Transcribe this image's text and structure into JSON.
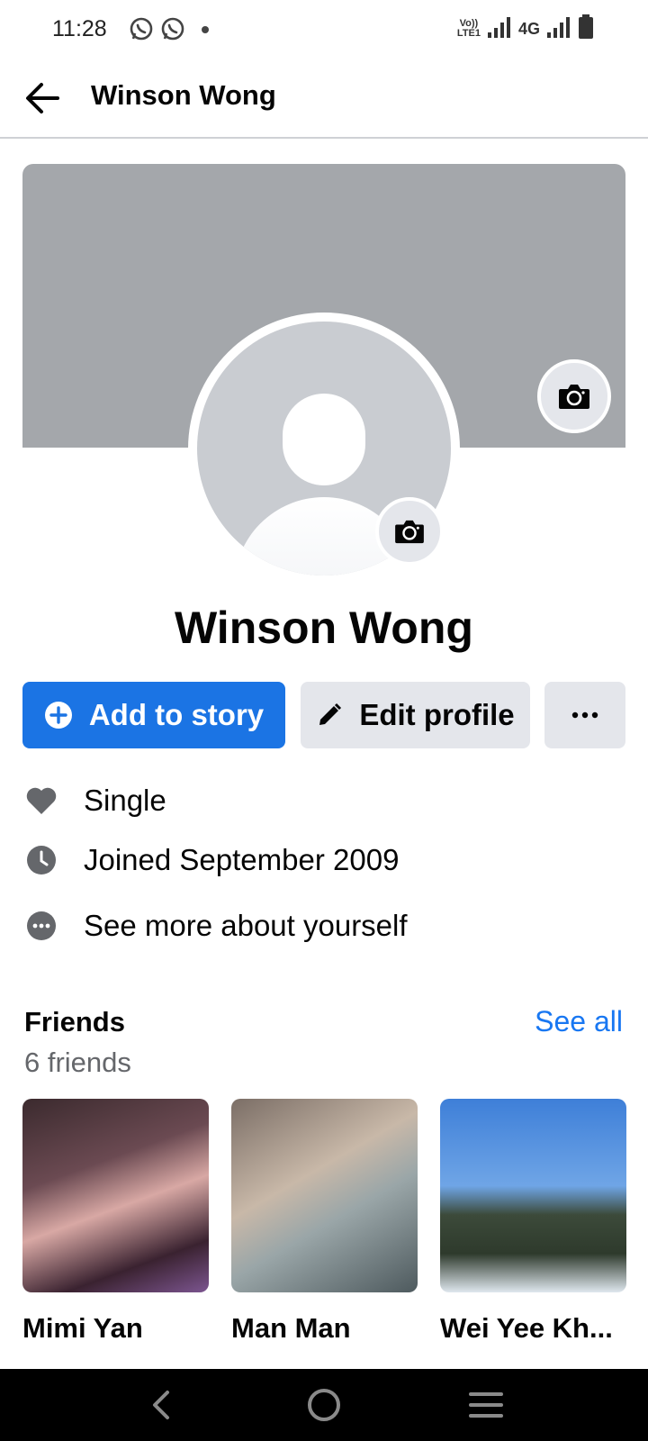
{
  "status_bar": {
    "time": "11:28",
    "volte_top": "Vo))",
    "volte_bottom": "LTE1",
    "network": "4G",
    "icons": [
      "whatsapp-icon",
      "whatsapp-icon",
      "notification-dot",
      "signal-icon",
      "signal-icon",
      "battery-icon"
    ]
  },
  "app_bar": {
    "back_icon": "arrow-left-icon",
    "title": "Winson Wong"
  },
  "profile": {
    "name": "Winson Wong",
    "cover_camera_icon": "camera-icon",
    "avatar_camera_icon": "camera-icon"
  },
  "actions": {
    "add_story_label": "Add to story",
    "edit_profile_label": "Edit profile",
    "more_icon": "more-horizontal-icon",
    "accent_color": "#1b74e4"
  },
  "intro": [
    {
      "icon": "heart-icon",
      "text": "Single"
    },
    {
      "icon": "clock-icon",
      "text": "Joined September 2009"
    },
    {
      "icon": "more-circle-icon",
      "text": "See more about yourself"
    }
  ],
  "friends": {
    "title": "Friends",
    "count": "6 friends",
    "see_all": "See all",
    "list": [
      {
        "name": "Mimi Yan"
      },
      {
        "name": "Man Man"
      },
      {
        "name": "Wei Yee Kh..."
      }
    ]
  },
  "nav_bar": {
    "icons": [
      "nav-back-icon",
      "nav-home-icon",
      "nav-menu-icon"
    ]
  }
}
